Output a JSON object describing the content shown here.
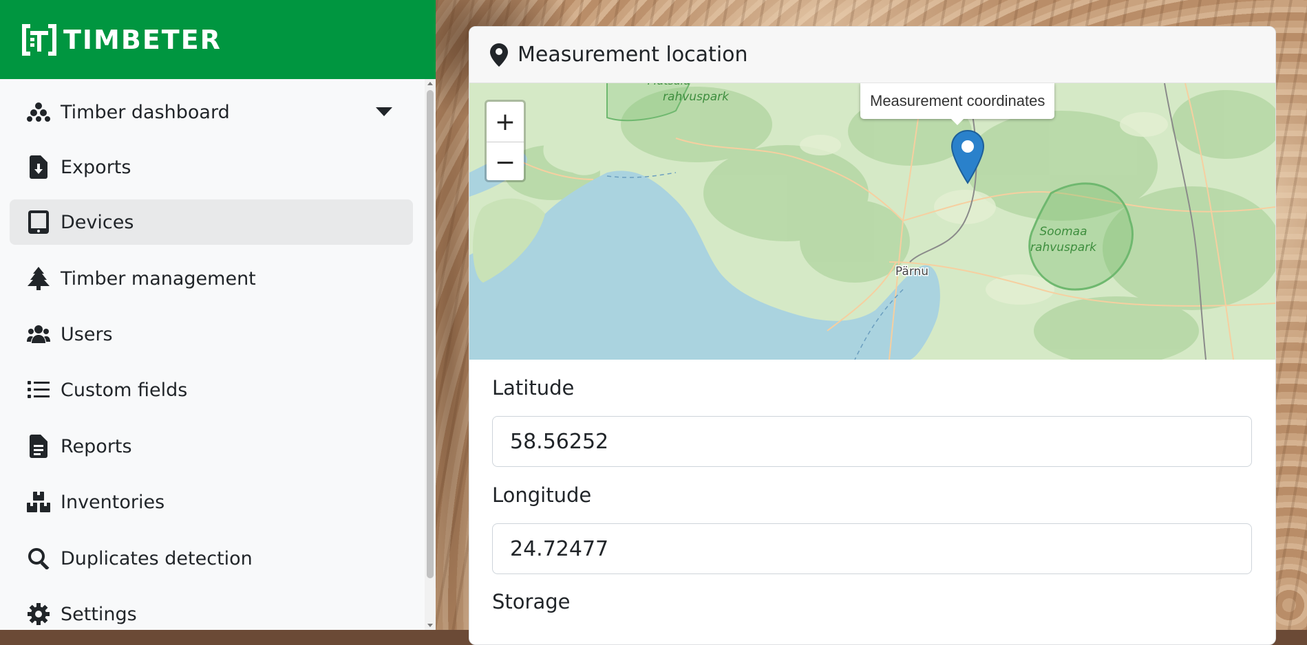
{
  "brand": {
    "name": "TIMBETER",
    "color": "#009640"
  },
  "sidebar": {
    "items": [
      {
        "label": "Timber dashboard",
        "icon": "dashboard-dots-icon",
        "active": false,
        "has_caret": true
      },
      {
        "label": "Exports",
        "icon": "file-download-icon",
        "active": false
      },
      {
        "label": "Devices",
        "icon": "tablet-icon",
        "active": true
      },
      {
        "label": "Timber management",
        "icon": "tree-icon",
        "active": false
      },
      {
        "label": "Users",
        "icon": "users-icon",
        "active": false
      },
      {
        "label": "Custom fields",
        "icon": "list-icon",
        "active": false
      },
      {
        "label": "Reports",
        "icon": "file-text-icon",
        "active": false
      },
      {
        "label": "Inventories",
        "icon": "boxes-icon",
        "active": false
      },
      {
        "label": "Duplicates detection",
        "icon": "search-icon",
        "active": false
      },
      {
        "label": "Settings",
        "icon": "gear-icon",
        "active": false
      }
    ]
  },
  "card": {
    "title": "Measurement location",
    "icon": "map-marker-icon"
  },
  "map": {
    "tooltip": "Measurement coordinates",
    "zoom_in": "+",
    "zoom_out": "−",
    "labels": {
      "park_top": "rahvuspark",
      "park_top_partial": "Matsalu",
      "soomaa_1": "Soomaa",
      "soomaa_2": "rahvuspark",
      "city": "Pärnu"
    },
    "colors": {
      "land": "#cde6bf",
      "water": "#aad3df",
      "forest": "#add19e",
      "park_border": "#6fb86f"
    }
  },
  "form": {
    "latitude_label": "Latitude",
    "latitude_value": "58.56252",
    "longitude_label": "Longitude",
    "longitude_value": "24.72477",
    "storage_label": "Storage"
  }
}
